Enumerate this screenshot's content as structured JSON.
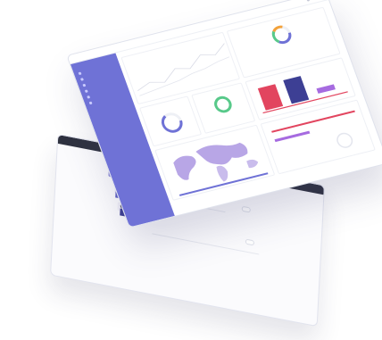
{
  "back_tablet": {
    "header_label": "",
    "caption": "",
    "link": "",
    "buttons": [
      "",
      ""
    ]
  },
  "dashboard": {
    "sidebar": {
      "title": "",
      "items": [
        "",
        "",
        "",
        "",
        "",
        ""
      ]
    },
    "colors": {
      "accent": "#6f72d6",
      "red": "#e2455f",
      "navy": "#3d3f94",
      "purple": "#a66be0",
      "map": "#b8a6e6",
      "green": "#58c98a",
      "orange": "#f3a23b"
    },
    "cards": {
      "stat_a": "",
      "stat_b": "",
      "stat_c": ""
    }
  }
}
